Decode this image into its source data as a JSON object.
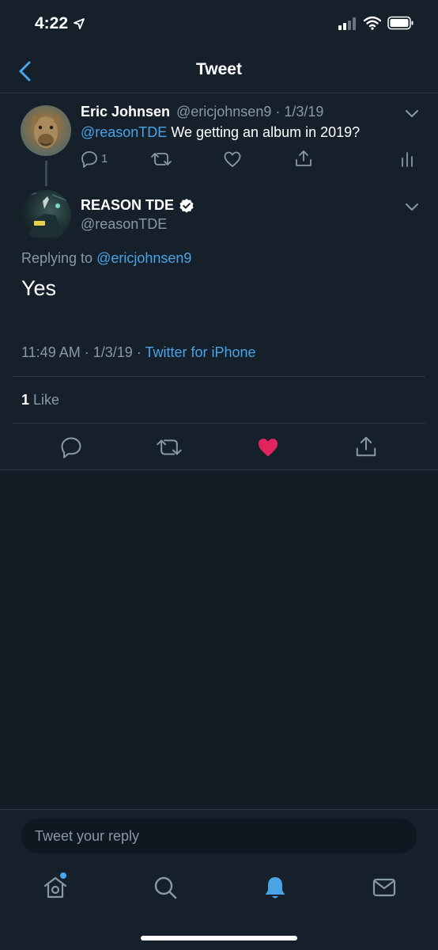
{
  "status_bar": {
    "time": "4:22"
  },
  "header": {
    "title": "Tweet"
  },
  "parent_tweet": {
    "name": "Eric Johnsen",
    "meta": "@ericjohnsen9 · 1/3/19",
    "mention": "@reasonTDE",
    "text": " We getting an album in 2019?",
    "reply_count": "1"
  },
  "main_tweet": {
    "name": "REASON TDE",
    "handle": "@reasonTDE",
    "replying_prefix": "Replying to ",
    "replying_handle": "@ericjohnsen9",
    "text": "Yes",
    "time_date": "11:49 AM · 1/3/19 · ",
    "source": "Twitter for iPhone",
    "like_count": "1",
    "like_label": " Like"
  },
  "reply_box": {
    "placeholder": "Tweet your reply"
  },
  "colors": {
    "accent": "#4aa3e6",
    "like": "#e0245e",
    "background": "#15202b"
  },
  "icons": [
    "location-arrow-icon",
    "signal-icon",
    "wifi-icon",
    "battery-icon",
    "back-chevron-icon",
    "chevron-down-icon",
    "reply-icon",
    "retweet-icon",
    "like-icon",
    "share-icon",
    "analytics-icon",
    "verified-icon",
    "home-icon",
    "search-icon",
    "bell-icon",
    "mail-icon"
  ]
}
